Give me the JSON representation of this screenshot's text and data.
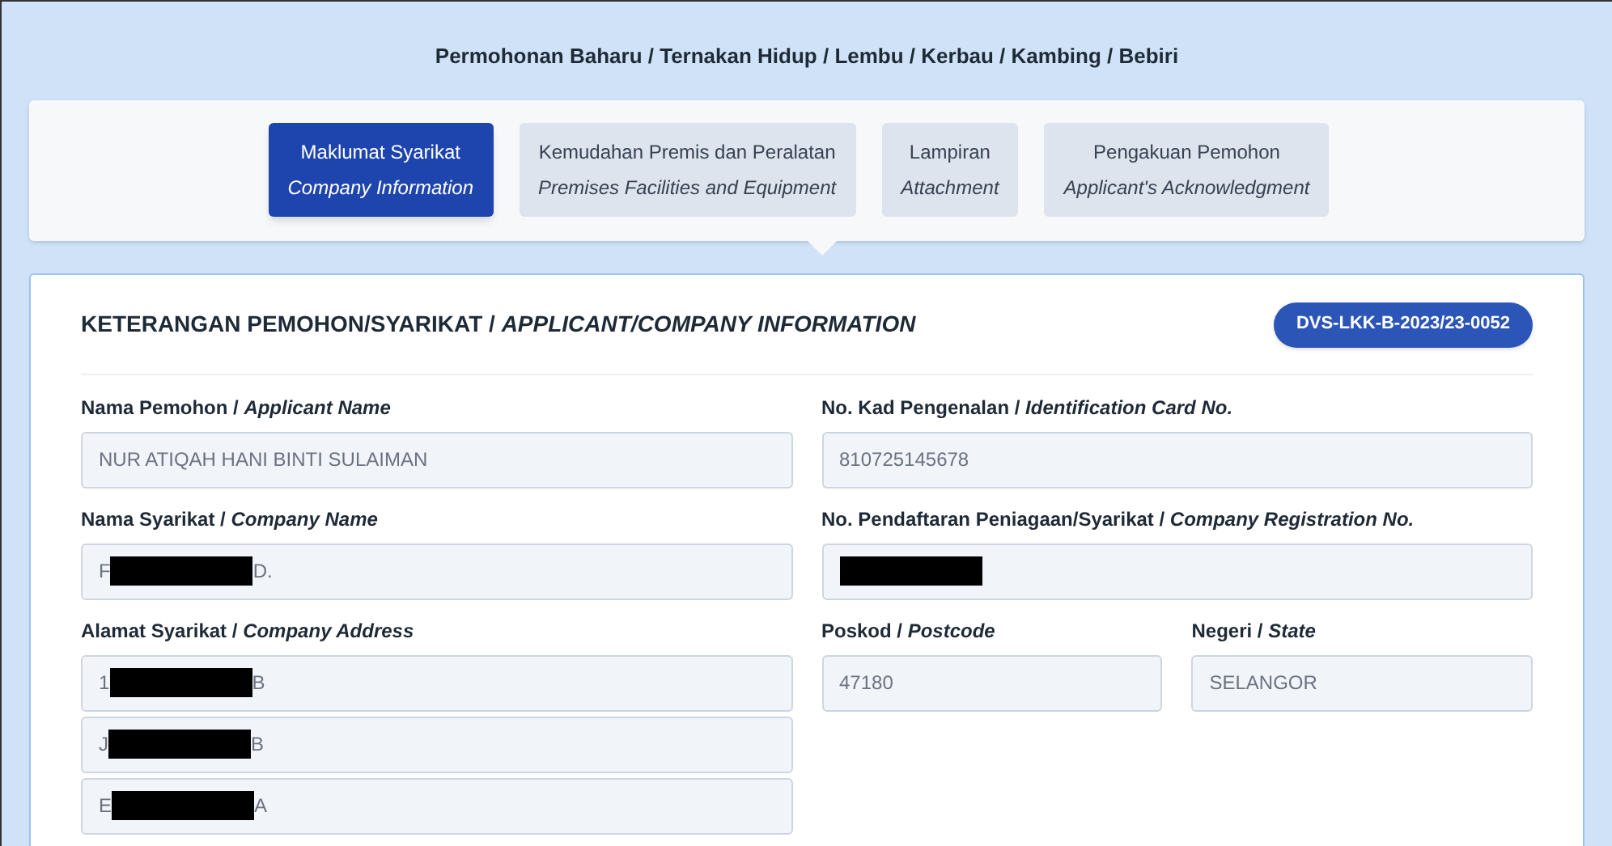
{
  "breadcrumb": "Permohonan Baharu / Ternakan Hidup / Lembu / Kerbau / Kambing / Bebiri",
  "steps": [
    {
      "label": "Maklumat Syarikat",
      "label_en": "Company Information",
      "selected": true
    },
    {
      "label": "Kemudahan Premis dan Peralatan",
      "label_en": "Premises Facilities and Equipment",
      "selected": false
    },
    {
      "label": "Lampiran",
      "label_en": "Attachment",
      "selected": false
    },
    {
      "label": "Pengakuan Pemohon",
      "label_en": "Applicant's Acknowledgment",
      "selected": false
    }
  ],
  "section": {
    "title": "KETERANGAN PEMOHON/SYARIKAT / *APPLICANT/COMPANY INFORMATION*",
    "reference": "DVS-LKK-B-2023/23-0052"
  },
  "left_fields": [
    {
      "label": "Nama Pemohon / *Applicant Name*",
      "lines": [
        {
          "value": "NUR ATIQAH HANI BINTI SULAIMAN",
          "redacted": false
        }
      ]
    },
    {
      "label": "Nama Syarikat / *Company Name*",
      "lines": [
        {
          "value": "F",
          "value_end": "D.",
          "redacted": true
        }
      ]
    },
    {
      "label": "Alamat Syarikat / *Company Address*",
      "lines": [
        {
          "value": "1",
          "value_end": "B",
          "redacted": true
        },
        {
          "value": "J",
          "value_end": "B",
          "redacted": true
        },
        {
          "value": "E",
          "value_end": "A",
          "redacted": true
        }
      ]
    }
  ],
  "right_fields": [
    {
      "label": "No. Kad Pengenalan / *Identification Card No.*",
      "lines": [
        {
          "value": "810725145678",
          "redacted": false
        }
      ]
    },
    {
      "label": "No. Pendaftaran Peniagaan/Syarikat / *Company Registration No.*",
      "lines": [
        {
          "redacted": true
        }
      ]
    }
  ],
  "address_fields": [
    {
      "label": "Poskod / *Postcode*",
      "value": "47180"
    },
    {
      "label": "Negeri / *State*",
      "value": "SELANGOR"
    }
  ]
}
